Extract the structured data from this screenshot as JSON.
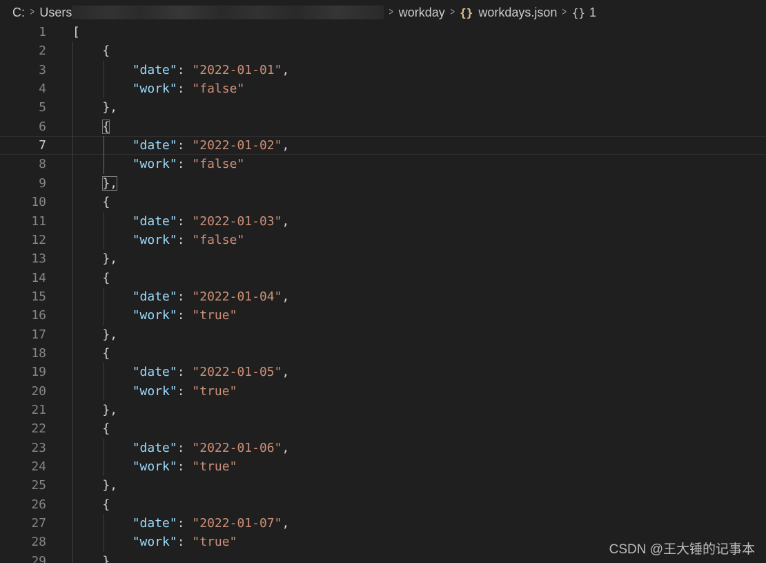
{
  "breadcrumb": {
    "drive": "C:",
    "users": "Users",
    "folder": "workday",
    "file": "workdays.json",
    "symbol": "1"
  },
  "icons": {
    "file_icon": "json-braces-icon",
    "symbol_icon": "object-braces-icon",
    "separator": "chevron-right-icon"
  },
  "colors": {
    "background": "#1f1f1f",
    "key": "#9cdcfe",
    "string": "#ce9178",
    "punctuation": "#d4d4d4",
    "line_number": "#858585",
    "json_icon": "#e2c08d"
  },
  "editor": {
    "current_line": 7,
    "open_array": "[",
    "open_brace": "{",
    "close_brace": "},",
    "records": [
      {
        "date": "2022-01-01",
        "work": "false"
      },
      {
        "date": "2022-01-02",
        "work": "false"
      },
      {
        "date": "2022-01-03",
        "work": "false"
      },
      {
        "date": "2022-01-04",
        "work": "true"
      },
      {
        "date": "2022-01-05",
        "work": "true"
      },
      {
        "date": "2022-01-06",
        "work": "true"
      },
      {
        "date": "2022-01-07",
        "work": "true"
      }
    ],
    "last_visible_line": "29"
  },
  "watermark": "CSDN @王大锤的记事本"
}
